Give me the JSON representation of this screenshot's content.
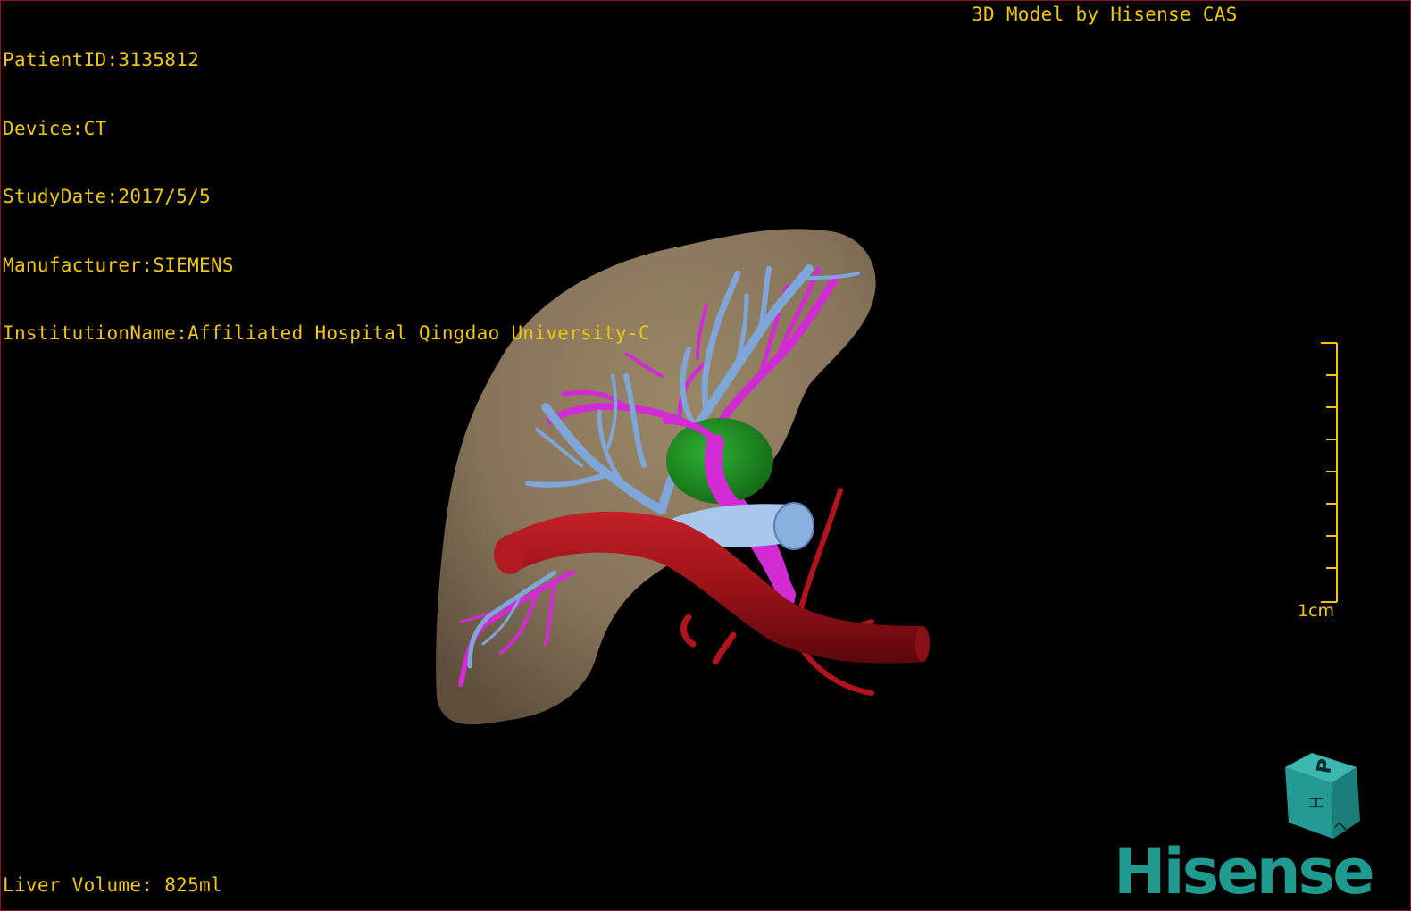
{
  "overlay": {
    "patient_id": "PatientID:3135812",
    "device": "Device:CT",
    "study_date": "StudyDate:2017/5/5",
    "manufacturer": "Manufacturer:SIEMENS",
    "institution": "InstitutionName:Affiliated Hospital Qingdao University-C",
    "model_credit": "3D Model by Hisense CAS",
    "liver_volume": "Liver Volume: 825ml"
  },
  "scale_bar": {
    "label": "1cm"
  },
  "orientation_cube": {
    "face_top": "H",
    "face_front": "P",
    "face_side": "L"
  },
  "brand": {
    "logo_text": "Hisense"
  },
  "colors": {
    "text": "#f0c800",
    "liver": "#8c7a5e",
    "hepatic_vein": "#7fa6d8",
    "portal_vein": "#d22ad4",
    "vena_cava": "#a3141a",
    "lesion": "#1e8a22",
    "brand": "#1f9a8e"
  }
}
